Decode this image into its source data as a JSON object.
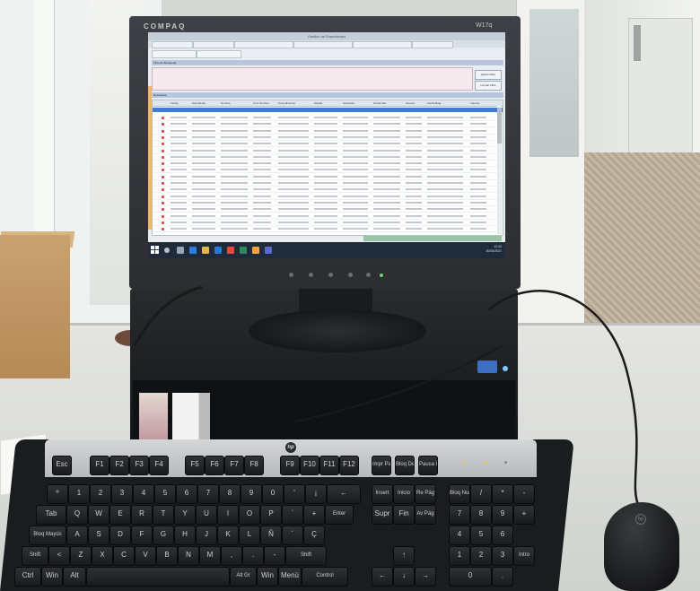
{
  "monitor": {
    "brand": "COMPAQ",
    "model": "W17q"
  },
  "computer_brand": "hp",
  "screen": {
    "app_window_title": "Gestión de Expedientes",
    "tabs": [
      "",
      "",
      "",
      "",
      "",
      "",
      ""
    ],
    "section_filter_label": "Filtro de Búsqueda",
    "section_results_label": "Resultados",
    "button_1": "Aplicar Filtro",
    "button_2": "Limpiar Filtro",
    "grid_columns": [
      "",
      "Fecha",
      "Expediente",
      "Nombre",
      "Cód. Servicio",
      "Procedimiento",
      "Estado",
      "Ubicación",
      "Fecha Alta",
      "Usuario",
      "Fecha Baja",
      "Importe"
    ],
    "grid_rows_count_visible": 18,
    "taskbar_clock": "12:40\n30/06/2021"
  },
  "keyboard": {
    "row_function": [
      "Esc",
      "F1",
      "F2",
      "F3",
      "F4",
      "F5",
      "F6",
      "F7",
      "F8",
      "F9",
      "F10",
      "F11",
      "F12",
      "Impr Pant",
      "Bloq Despl",
      "Pausa Inter"
    ],
    "row_numbers": [
      "º",
      "1",
      "2",
      "3",
      "4",
      "5",
      "6",
      "7",
      "8",
      "9",
      "0",
      "'",
      "¡",
      "←"
    ],
    "row_q": [
      "Tab",
      "Q",
      "W",
      "E",
      "R",
      "T",
      "Y",
      "U",
      "I",
      "O",
      "P",
      "`",
      "+",
      "Enter"
    ],
    "row_a": [
      "Bloq Mayús",
      "A",
      "S",
      "D",
      "F",
      "G",
      "H",
      "J",
      "K",
      "L",
      "Ñ",
      "´",
      "Ç"
    ],
    "row_z": [
      "Shift",
      "<",
      "Z",
      "X",
      "C",
      "V",
      "B",
      "N",
      "M",
      ",",
      ".",
      "-",
      "Shift"
    ],
    "row_bottom": [
      "Ctrl",
      "Win",
      "Alt",
      "",
      "Alt Gr",
      "Win",
      "Menú",
      "Control"
    ],
    "nav_block": [
      "Insert",
      "Inicio",
      "Re Pág",
      "Supr",
      "Fin",
      "Av Pág"
    ],
    "numpad_top": [
      "Bloq Num",
      "/",
      "*",
      "-"
    ],
    "numpad": [
      "7",
      "8",
      "9",
      "+",
      "4",
      "5",
      "6",
      "1",
      "2",
      "3",
      "Intro",
      "0",
      "."
    ]
  },
  "colors": {
    "selected_row": "#3f7ad4",
    "filter_box": "#f6e9ee",
    "taskbar": "#1f2b3a",
    "cardboard": "#c9a26f"
  }
}
